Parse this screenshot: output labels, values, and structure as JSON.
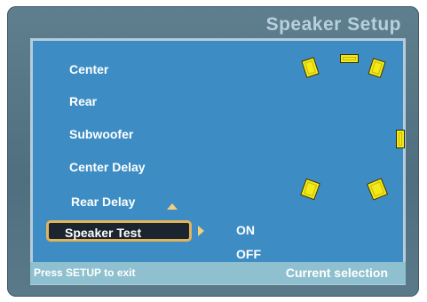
{
  "header": {
    "title": "Speaker Setup"
  },
  "menu": {
    "items": [
      {
        "label": "Center"
      },
      {
        "label": "Rear"
      },
      {
        "label": "Subwoofer"
      },
      {
        "label": "Center Delay"
      },
      {
        "label": "Rear Delay"
      }
    ],
    "selected": {
      "label": "Speaker Test"
    }
  },
  "options": [
    {
      "label": "ON"
    },
    {
      "label": "OFF"
    }
  ],
  "status": {
    "hint": "Press SETUP to exit",
    "info": "Current selection"
  },
  "colors": {
    "panel_bg": "#3d8dc4",
    "frame_bg": "#5f7f8e",
    "title": "#b7d0dd",
    "highlight_border": "#e3b35a",
    "speaker": "#f4ea17",
    "status_bar": "#8ec0cf"
  },
  "speakers": [
    "front-left-speaker",
    "center-speaker",
    "front-right-speaker",
    "subwoofer-speaker",
    "rear-left-speaker",
    "rear-right-speaker"
  ]
}
